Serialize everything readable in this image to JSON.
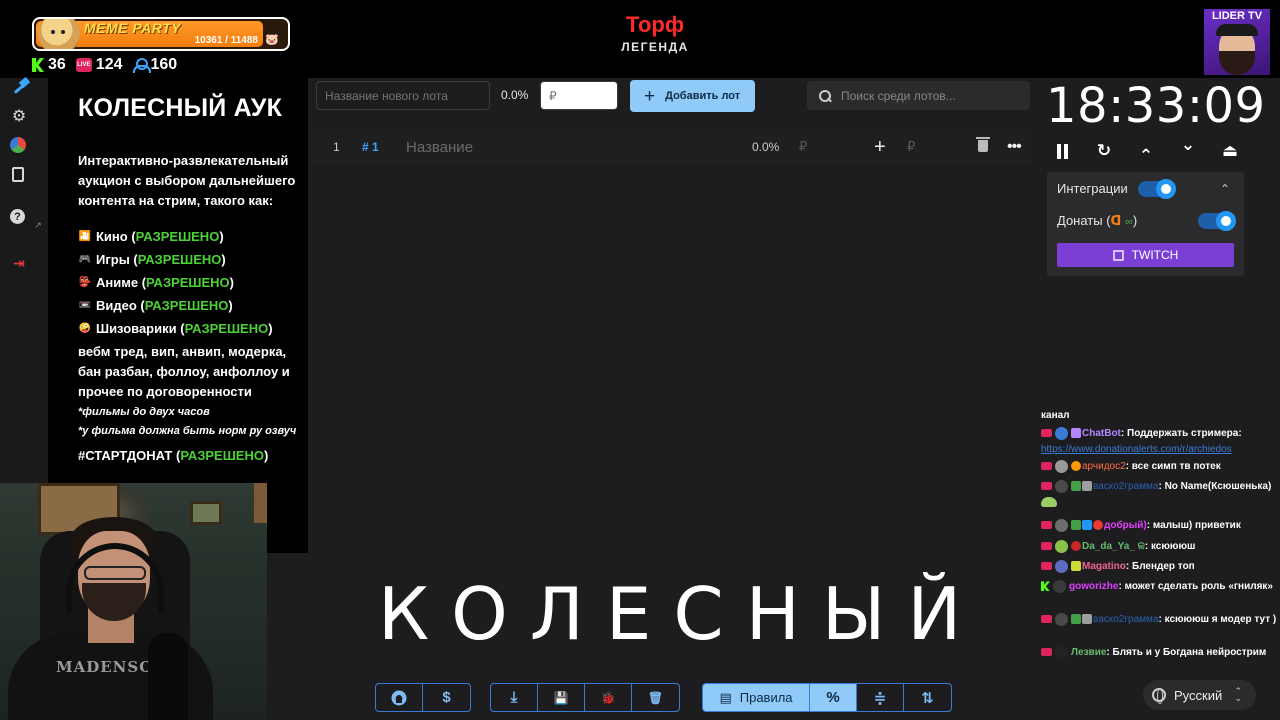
{
  "overlay": {
    "meme_title": "MEME PARTY",
    "meme_count": "10361 / 11488",
    "meme_progress": 0.902,
    "stats": {
      "kick": "36",
      "live": "124",
      "viewers": "160"
    },
    "live_badge": "LIVE",
    "channel_title": "Торф",
    "channel_subtitle": "ЛЕГЕНДА",
    "lider_label": "LIDER TV"
  },
  "sidebar": {
    "items": [
      {
        "name": "auction",
        "icon": "hammer-icon"
      },
      {
        "name": "settings",
        "icon": "gear-icon"
      },
      {
        "name": "statistics",
        "icon": "pie-chart-icon"
      },
      {
        "name": "history",
        "icon": "clipboard-icon"
      },
      {
        "name": "help",
        "icon": "question-icon"
      },
      {
        "name": "logout",
        "icon": "logout-icon"
      }
    ],
    "help_glyph": "?",
    "ext_glyph": "↗",
    "logout_glyph": "⇥"
  },
  "info": {
    "title": "КОЛЕСНЫЙ АУК",
    "description": "Интерактивно-развлекательный аукцион с выбором дальнейшего контента на стрим, такого как:",
    "categories": [
      {
        "emoji": "🎦",
        "label": "Кино (",
        "status": "РАЗРЕШЕНО",
        "close": ")"
      },
      {
        "emoji": "🎮",
        "label": "Игры (",
        "status": "РАЗРЕШЕНО",
        "close": ")"
      },
      {
        "emoji": "👺",
        "label": "Аниме (",
        "status": "РАЗРЕШЕНО",
        "close": ")"
      },
      {
        "emoji": "📼",
        "label": "Видео (",
        "status": "РАЗРЕШЕНО",
        "close": ")"
      },
      {
        "emoji": "🤪",
        "label": "Шизоварики (",
        "status": "РАЗРЕШЕНО",
        "close": ")"
      }
    ],
    "more": "вебм тред, вип, анвип, модерка, бан разбан, фоллоу, анфоллоу и прочее по договоренности",
    "notes": [
      "*фильмы до двух часов",
      "*у фильма должна быть норм ру озвуч"
    ],
    "tag_label": "#СТАРТДОНАТ (",
    "tag_status": "РАЗРЕШЕНО",
    "tag_close": ")"
  },
  "auction": {
    "new_lot_placeholder": "Название нового лота",
    "total_percent": "0.0%",
    "amount_placeholder": "₽",
    "add_button": "Добавить лот",
    "add_glyph": "+",
    "search_placeholder": "Поиск среди лотов...",
    "lots": [
      {
        "index": "1",
        "id": "# 1",
        "name": "Название",
        "percent": "0.0%",
        "currency": "₽",
        "add": "+",
        "currency2": "₽",
        "more": "•••"
      }
    ],
    "overlay_word": "КОЛЕСНЫЙ"
  },
  "toolbar": {
    "github": "github-icon",
    "donate_glyph": "$",
    "download_glyph": "⤓",
    "save_glyph": "💾",
    "bug_glyph": "🐞",
    "clear_glyph": "🗑",
    "rules_label": "Правила",
    "rules_glyph": "▤",
    "percent_glyph": "%",
    "merge_glyph": "≑",
    "sort_glyph": "⇅"
  },
  "timer": {
    "time": "18:33:09",
    "controls": {
      "reset": "↻",
      "up": "⌃",
      "down": "⌄",
      "top": "⏏"
    }
  },
  "integrations": {
    "title": "Интеграции",
    "donations_label": "Донаты (",
    "donations_close": ")",
    "da_glyph": "ᗡ",
    "inf_glyph": "∞",
    "twitch_button": "TWITCH",
    "chevron": "⌃",
    "integrations_on": true,
    "donations_on": true
  },
  "chat": {
    "lines": [
      {
        "name": "",
        "text": "канал"
      },
      {
        "name": "ChatBot",
        "text": "Поддержать стримера:",
        "link": "https://www.donationalerts.com/r/archiedos",
        "color": "#b388ff"
      },
      {
        "name": "арчидос2",
        "text": "все симп тв потек",
        "color": "#ff7043"
      },
      {
        "name": "васко2грамма",
        "text": "No Name(Ксюшенька)",
        "color": "#2a5fb0"
      },
      {
        "name": "добрый)",
        "text": "малыш) приветик",
        "color": "#e040fb"
      },
      {
        "name": "Da_da_Ya_ ଳ",
        "text": "ксюююш",
        "color": "#66bb6a"
      },
      {
        "name": "Magatino",
        "text": "Блендер топ",
        "color": "#f06292"
      },
      {
        "name": "goworizhe",
        "text": "может сделать роль «гниляк»",
        "color": "#e040fb"
      },
      {
        "name": "васко2грамма",
        "text": "ксюююш я модер тут )",
        "color": "#2a5fb0"
      },
      {
        "name": "Лезвие",
        "text": "Блять и у Богдана нейрострим",
        "color": "#66bb6a"
      }
    ]
  },
  "language": {
    "current": "Русский",
    "arrows": "⌃⌄"
  },
  "webcam": {
    "shirt_print": "MADENSORE"
  }
}
